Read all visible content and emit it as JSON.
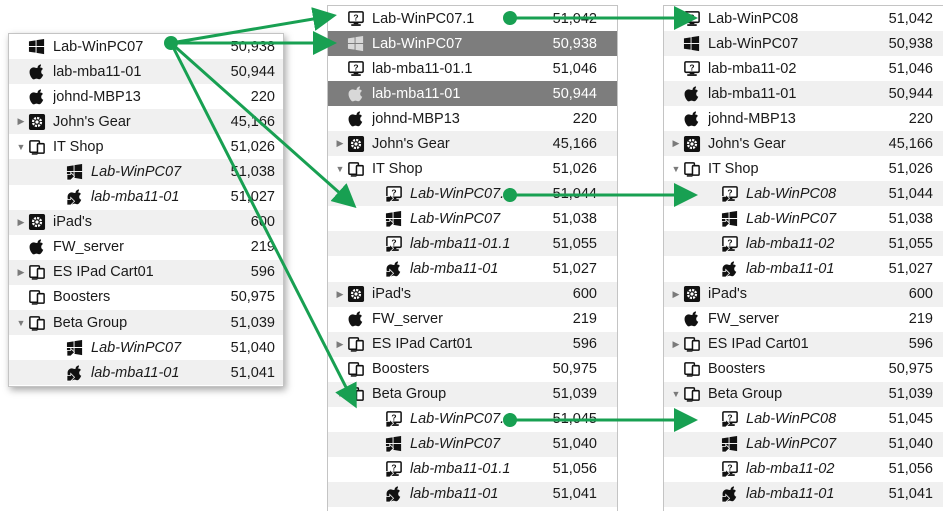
{
  "colors": {
    "arrow": "#18a052",
    "selected_row": "#7d7d7d",
    "alt_row": "#f0f0f0"
  },
  "panels": [
    {
      "id": "a",
      "rows": [
        {
          "label": "Lab-WinPC07",
          "value": "50,938",
          "icon": "windows-icon",
          "depth": 0,
          "tri": "",
          "italic": false
        },
        {
          "label": "lab-mba11-01",
          "value": "50,944",
          "icon": "apple-icon",
          "depth": 0,
          "tri": "",
          "italic": false
        },
        {
          "label": "johnd-MBP13",
          "value": "220",
          "icon": "apple-icon",
          "depth": 0,
          "tri": "",
          "italic": false
        },
        {
          "label": "John's Gear",
          "value": "45,166",
          "icon": "gear-icon",
          "depth": 0,
          "tri": "closed",
          "italic": false
        },
        {
          "label": "IT Shop",
          "value": "51,026",
          "icon": "devices-icon",
          "depth": 0,
          "tri": "open",
          "italic": false
        },
        {
          "label": "Lab-WinPC07",
          "value": "51,038",
          "icon": "windows-alias-icon",
          "depth": 1,
          "tri": "",
          "italic": true
        },
        {
          "label": "lab-mba11-01",
          "value": "51,027",
          "icon": "apple-alias-icon",
          "depth": 1,
          "tri": "",
          "italic": true
        },
        {
          "label": "iPad's",
          "value": "600",
          "icon": "gear-icon",
          "depth": 0,
          "tri": "closed",
          "italic": false
        },
        {
          "label": "FW_server",
          "value": "219",
          "icon": "apple-icon",
          "depth": 0,
          "tri": "",
          "italic": false
        },
        {
          "label": "ES IPad Cart01",
          "value": "596",
          "icon": "devices-icon",
          "depth": 0,
          "tri": "closed",
          "italic": false
        },
        {
          "label": "Boosters",
          "value": "50,975",
          "icon": "devices-icon",
          "depth": 0,
          "tri": "",
          "italic": false
        },
        {
          "label": "Beta Group",
          "value": "51,039",
          "icon": "devices-icon",
          "depth": 0,
          "tri": "open",
          "italic": false
        },
        {
          "label": "Lab-WinPC07",
          "value": "51,040",
          "icon": "windows-alias-icon",
          "depth": 1,
          "tri": "",
          "italic": true
        },
        {
          "label": "lab-mba11-01",
          "value": "51,041",
          "icon": "apple-alias-icon",
          "depth": 1,
          "tri": "",
          "italic": true
        }
      ]
    },
    {
      "id": "b",
      "rows": [
        {
          "label": "Lab-WinPC07.1",
          "value": "51,042",
          "icon": "unknown-icon",
          "depth": 0,
          "tri": "",
          "italic": false
        },
        {
          "label": "Lab-WinPC07",
          "value": "50,938",
          "icon": "windows-icon",
          "depth": 0,
          "tri": "",
          "italic": false,
          "selected": true
        },
        {
          "label": "lab-mba11-01.1",
          "value": "51,046",
          "icon": "unknown-icon",
          "depth": 0,
          "tri": "",
          "italic": false
        },
        {
          "label": "lab-mba11-01",
          "value": "50,944",
          "icon": "apple-icon",
          "depth": 0,
          "tri": "",
          "italic": false,
          "selected": true
        },
        {
          "label": "johnd-MBP13",
          "value": "220",
          "icon": "apple-icon",
          "depth": 0,
          "tri": "",
          "italic": false
        },
        {
          "label": "John's Gear",
          "value": "45,166",
          "icon": "gear-icon",
          "depth": 0,
          "tri": "closed",
          "italic": false
        },
        {
          "label": "IT Shop",
          "value": "51,026",
          "icon": "devices-icon",
          "depth": 0,
          "tri": "open",
          "italic": false
        },
        {
          "label": "Lab-WinPC07.1",
          "value": "51,044",
          "icon": "unknown-alias-icon",
          "depth": 1,
          "tri": "",
          "italic": true
        },
        {
          "label": "Lab-WinPC07",
          "value": "51,038",
          "icon": "windows-alias-icon",
          "depth": 1,
          "tri": "",
          "italic": true
        },
        {
          "label": "lab-mba11-01.1",
          "value": "51,055",
          "icon": "unknown-alias-icon",
          "depth": 1,
          "tri": "",
          "italic": true
        },
        {
          "label": "lab-mba11-01",
          "value": "51,027",
          "icon": "apple-alias-icon",
          "depth": 1,
          "tri": "",
          "italic": true
        },
        {
          "label": "iPad's",
          "value": "600",
          "icon": "gear-icon",
          "depth": 0,
          "tri": "closed",
          "italic": false
        },
        {
          "label": "FW_server",
          "value": "219",
          "icon": "apple-icon",
          "depth": 0,
          "tri": "",
          "italic": false
        },
        {
          "label": "ES IPad Cart01",
          "value": "596",
          "icon": "devices-icon",
          "depth": 0,
          "tri": "closed",
          "italic": false
        },
        {
          "label": "Boosters",
          "value": "50,975",
          "icon": "devices-icon",
          "depth": 0,
          "tri": "",
          "italic": false
        },
        {
          "label": "Beta Group",
          "value": "51,039",
          "icon": "devices-icon",
          "depth": 0,
          "tri": "open",
          "italic": false
        },
        {
          "label": "Lab-WinPC07.1",
          "value": "51,045",
          "icon": "unknown-alias-icon",
          "depth": 1,
          "tri": "",
          "italic": true
        },
        {
          "label": "Lab-WinPC07",
          "value": "51,040",
          "icon": "windows-alias-icon",
          "depth": 1,
          "tri": "",
          "italic": true
        },
        {
          "label": "lab-mba11-01.1",
          "value": "51,056",
          "icon": "unknown-alias-icon",
          "depth": 1,
          "tri": "",
          "italic": true
        },
        {
          "label": "lab-mba11-01",
          "value": "51,041",
          "icon": "apple-alias-icon",
          "depth": 1,
          "tri": "",
          "italic": true
        }
      ]
    },
    {
      "id": "c",
      "rows": [
        {
          "label": "Lab-WinPC08",
          "value": "51,042",
          "icon": "unknown-icon",
          "depth": 0,
          "tri": "",
          "italic": false
        },
        {
          "label": "Lab-WinPC07",
          "value": "50,938",
          "icon": "windows-icon",
          "depth": 0,
          "tri": "",
          "italic": false
        },
        {
          "label": "lab-mba11-02",
          "value": "51,046",
          "icon": "unknown-icon",
          "depth": 0,
          "tri": "",
          "italic": false
        },
        {
          "label": "lab-mba11-01",
          "value": "50,944",
          "icon": "apple-icon",
          "depth": 0,
          "tri": "",
          "italic": false
        },
        {
          "label": "johnd-MBP13",
          "value": "220",
          "icon": "apple-icon",
          "depth": 0,
          "tri": "",
          "italic": false
        },
        {
          "label": "John's Gear",
          "value": "45,166",
          "icon": "gear-icon",
          "depth": 0,
          "tri": "closed",
          "italic": false
        },
        {
          "label": "IT Shop",
          "value": "51,026",
          "icon": "devices-icon",
          "depth": 0,
          "tri": "open",
          "italic": false
        },
        {
          "label": "Lab-WinPC08",
          "value": "51,044",
          "icon": "unknown-alias-icon",
          "depth": 1,
          "tri": "",
          "italic": true
        },
        {
          "label": "Lab-WinPC07",
          "value": "51,038",
          "icon": "windows-alias-icon",
          "depth": 1,
          "tri": "",
          "italic": true
        },
        {
          "label": "lab-mba11-02",
          "value": "51,055",
          "icon": "unknown-alias-icon",
          "depth": 1,
          "tri": "",
          "italic": true
        },
        {
          "label": "lab-mba11-01",
          "value": "51,027",
          "icon": "apple-alias-icon",
          "depth": 1,
          "tri": "",
          "italic": true
        },
        {
          "label": "iPad's",
          "value": "600",
          "icon": "gear-icon",
          "depth": 0,
          "tri": "closed",
          "italic": false
        },
        {
          "label": "FW_server",
          "value": "219",
          "icon": "apple-icon",
          "depth": 0,
          "tri": "",
          "italic": false
        },
        {
          "label": "ES IPad Cart01",
          "value": "596",
          "icon": "devices-icon",
          "depth": 0,
          "tri": "closed",
          "italic": false
        },
        {
          "label": "Boosters",
          "value": "50,975",
          "icon": "devices-icon",
          "depth": 0,
          "tri": "",
          "italic": false
        },
        {
          "label": "Beta Group",
          "value": "51,039",
          "icon": "devices-icon",
          "depth": 0,
          "tri": "open",
          "italic": false
        },
        {
          "label": "Lab-WinPC08",
          "value": "51,045",
          "icon": "unknown-alias-icon",
          "depth": 1,
          "tri": "",
          "italic": true
        },
        {
          "label": "Lab-WinPC07",
          "value": "51,040",
          "icon": "windows-alias-icon",
          "depth": 1,
          "tri": "",
          "italic": true
        },
        {
          "label": "lab-mba11-02",
          "value": "51,056",
          "icon": "unknown-alias-icon",
          "depth": 1,
          "tri": "",
          "italic": true
        },
        {
          "label": "lab-mba11-01",
          "value": "51,041",
          "icon": "apple-alias-icon",
          "depth": 1,
          "tri": "",
          "italic": true
        }
      ]
    }
  ]
}
